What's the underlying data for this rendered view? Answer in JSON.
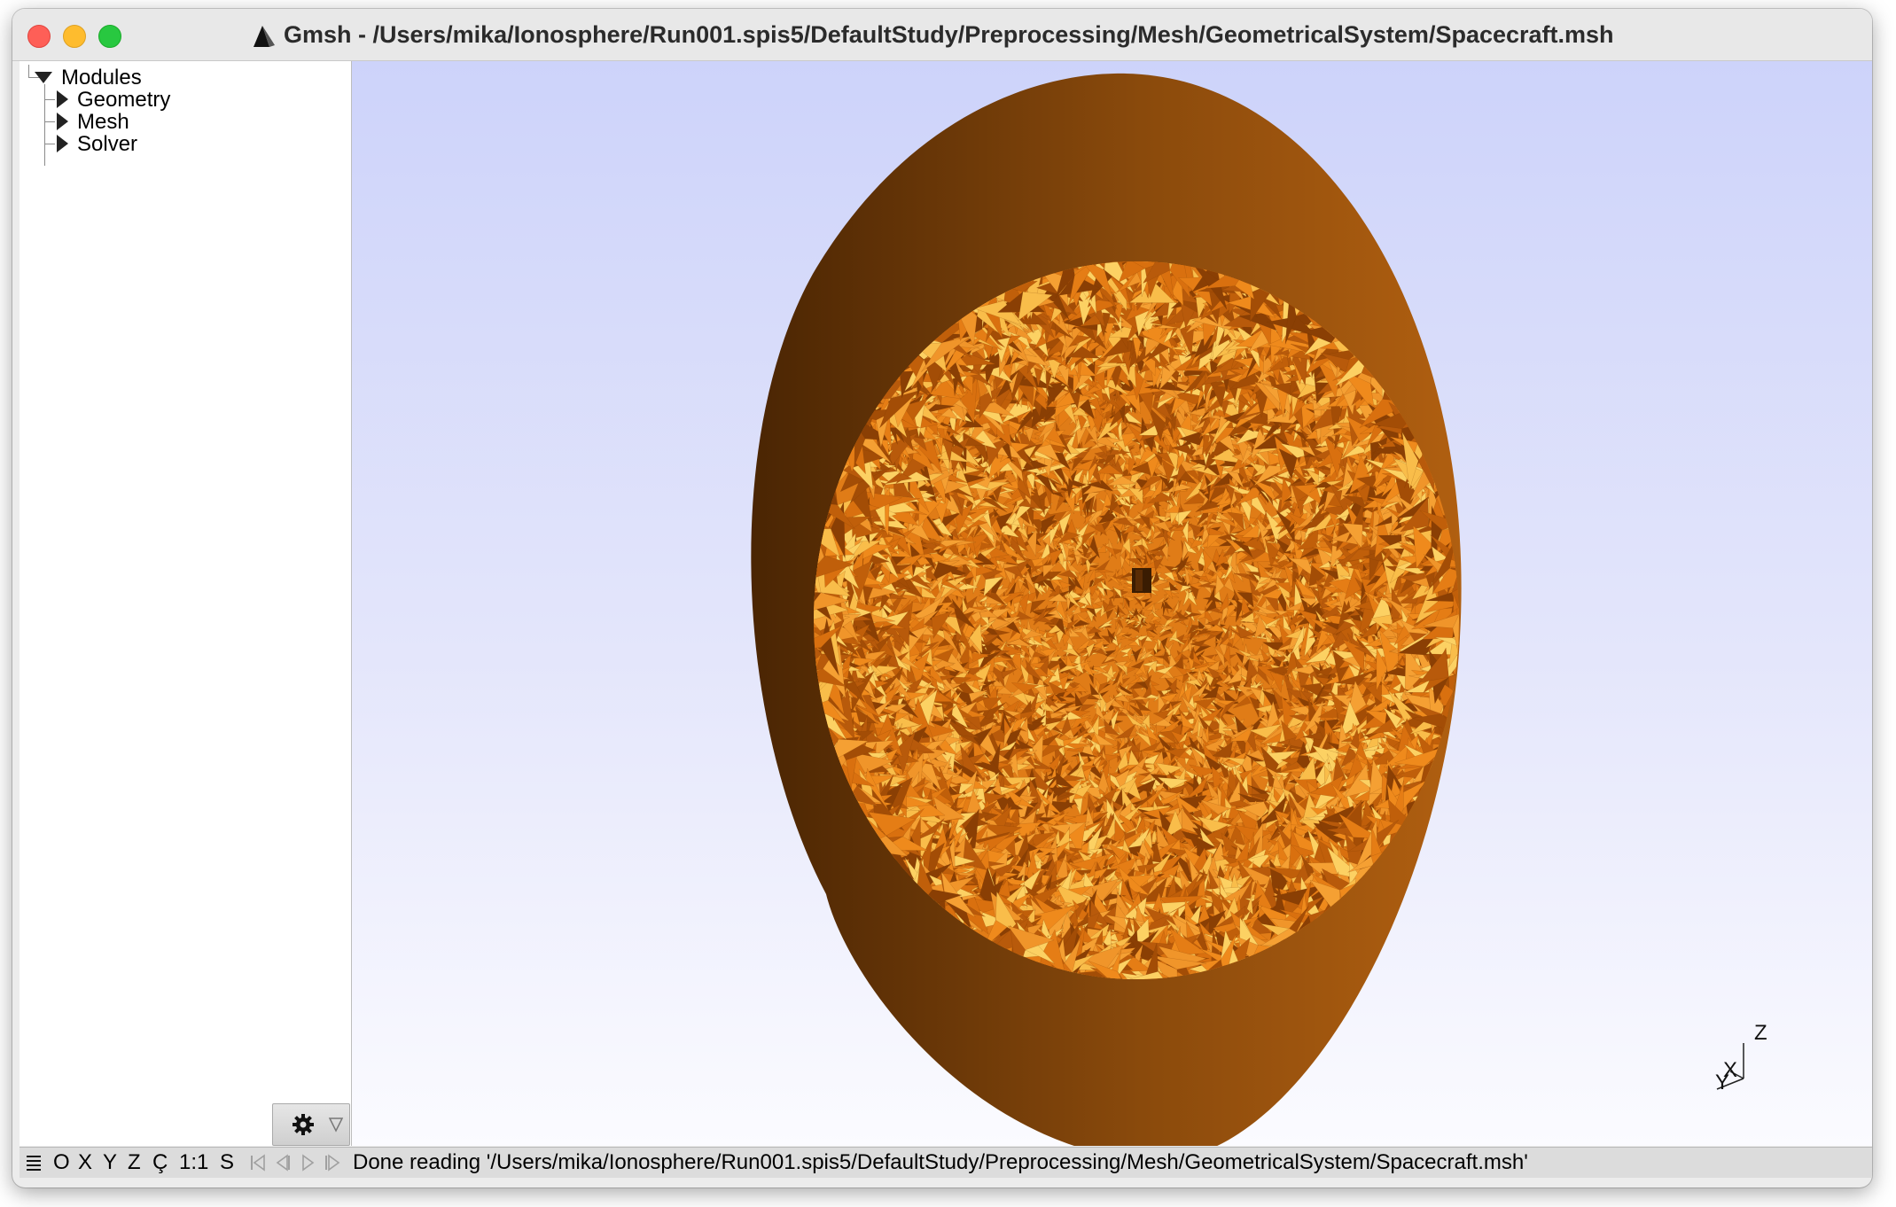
{
  "window": {
    "title": "Gmsh - /Users/mika/Ionosphere/Run001.spis5/DefaultStudy/Preprocessing/Mesh/GeometricalSystem/Spacecraft.msh"
  },
  "tree": {
    "root_label": "Modules",
    "items": [
      {
        "label": "Geometry"
      },
      {
        "label": "Mesh"
      },
      {
        "label": "Solver"
      }
    ]
  },
  "statusbar": {
    "menu_icon": "hamburger-icon",
    "buttons": [
      "O",
      "X",
      "Y",
      "Z",
      "Ç",
      "1:1",
      "S"
    ],
    "nav_icons": [
      "first-icon",
      "prev-icon",
      "play-icon",
      "last-icon"
    ],
    "message": "Done reading '/Users/mika/Ionosphere/Run001.spis5/DefaultStudy/Preprocessing/Mesh/GeometricalSystem/Spacecraft.msh'"
  },
  "axes": {
    "z_label": "Z",
    "x_label": "X",
    "y_label": "Y"
  },
  "colors": {
    "mesh_face": "#f28a1e",
    "mesh_rim": "#6e3a08",
    "background_top": "#cdd3fa",
    "background_bottom": "#fbfbff"
  }
}
